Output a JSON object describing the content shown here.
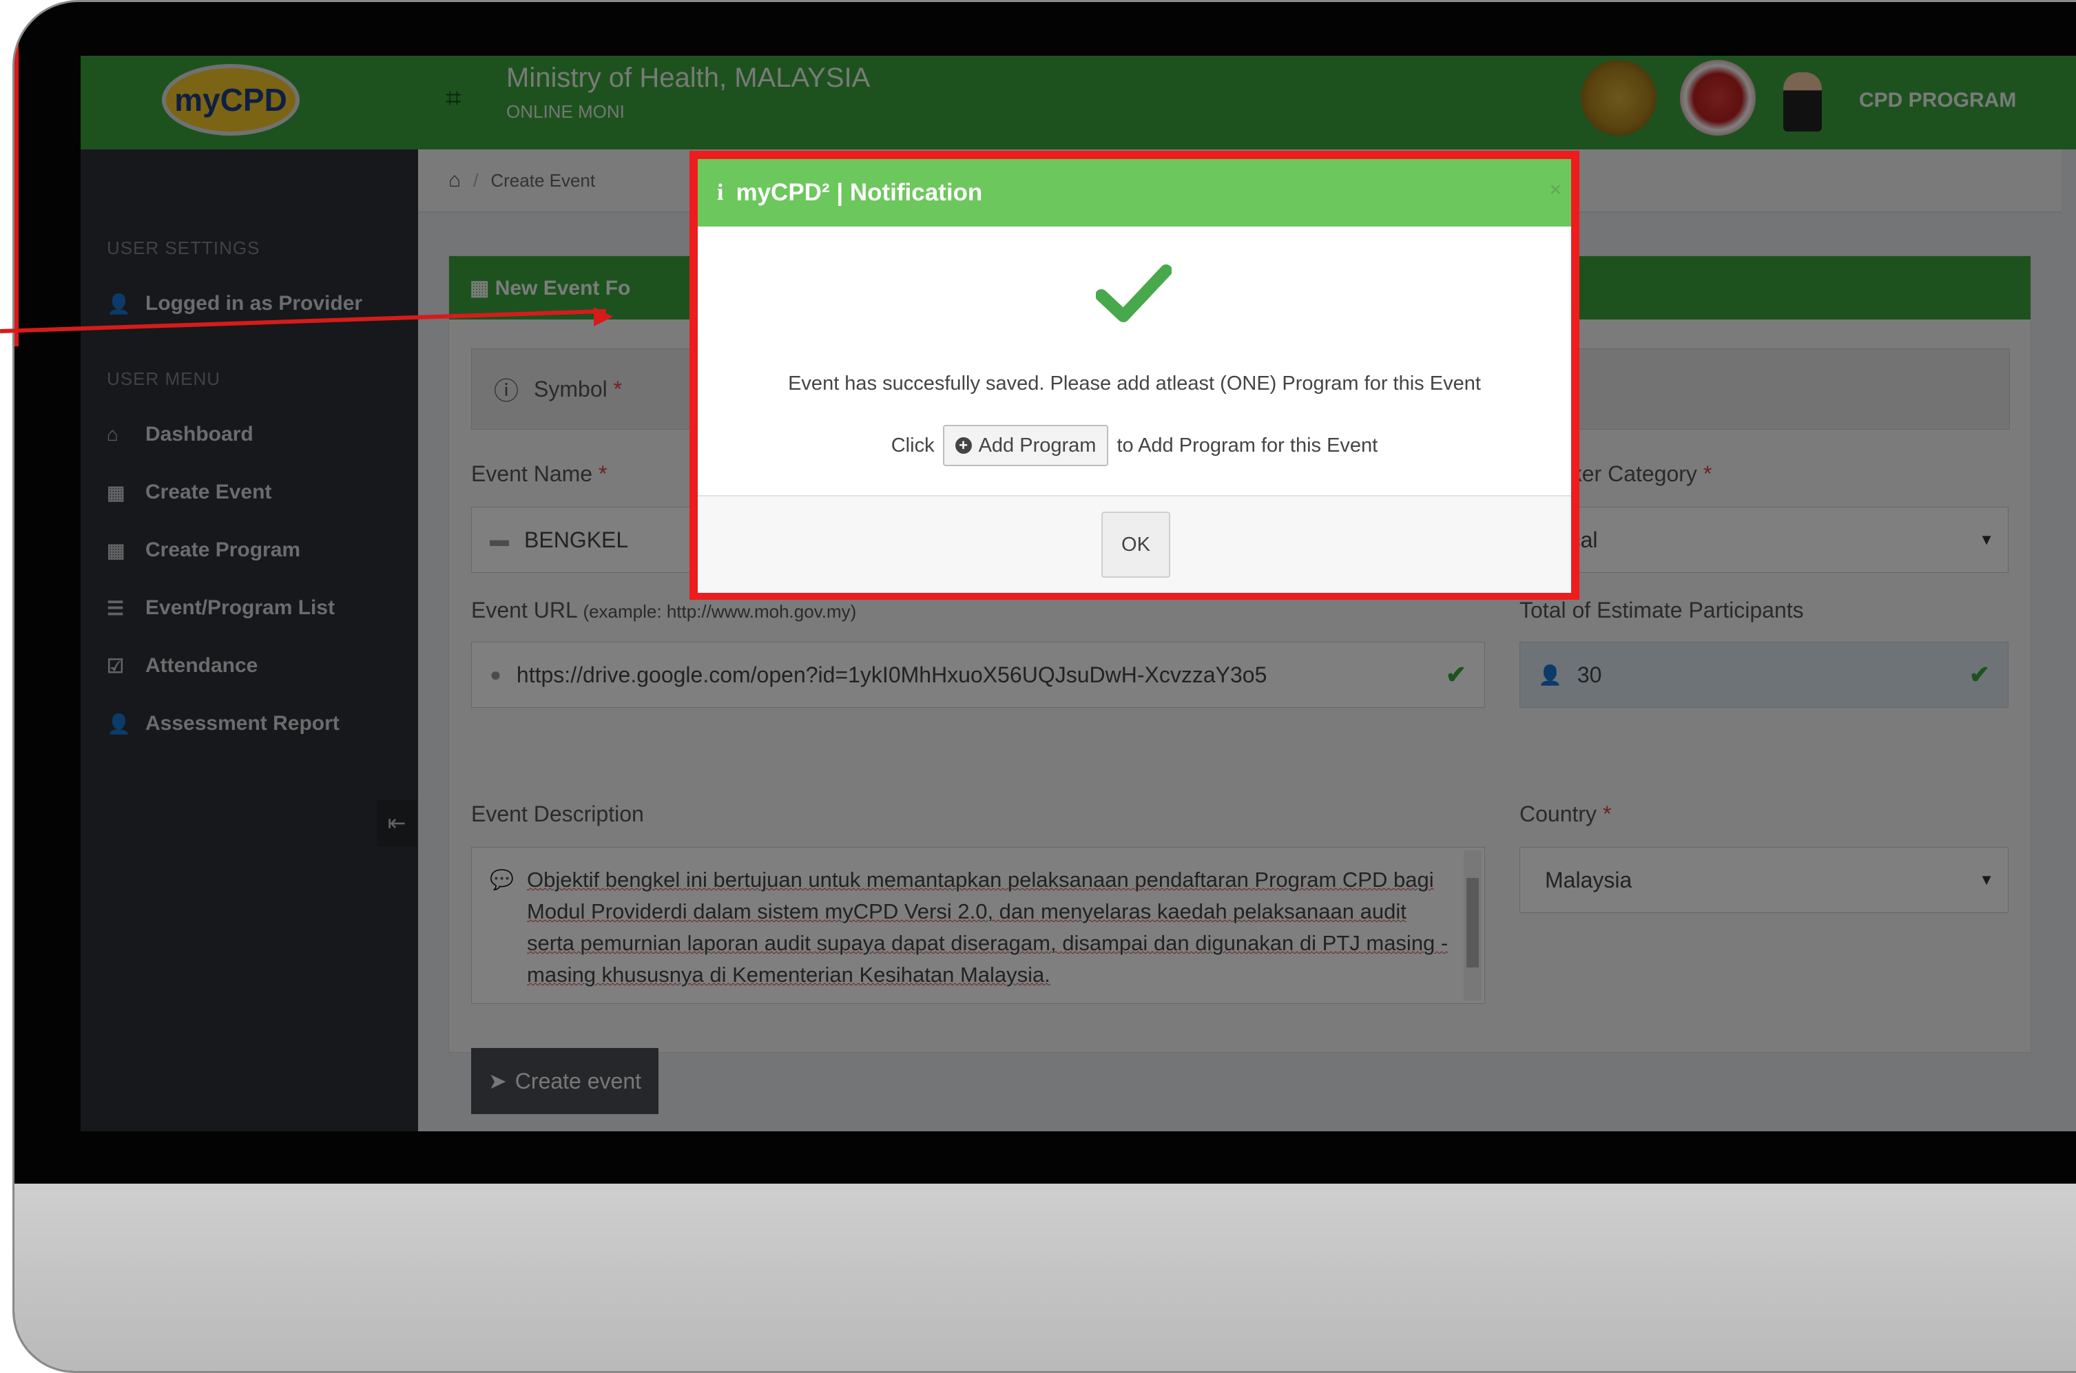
{
  "header": {
    "logo_text": "myCPD",
    "title": "Ministry of Health, MALAYSIA",
    "subtitle": "ONLINE MONI",
    "program_label": "CPD PROGRAM"
  },
  "sidebar": {
    "settings_heading": "USER SETTINGS",
    "logged_in": "Logged in as Provider",
    "menu_heading": "USER MENU",
    "items": [
      {
        "label": "Dashboard",
        "icon": "home-icon"
      },
      {
        "label": "Create Event",
        "icon": "calendar-icon"
      },
      {
        "label": "Create Program",
        "icon": "calendar-icon"
      },
      {
        "label": "Event/Program List",
        "icon": "list-icon"
      },
      {
        "label": "Attendance",
        "icon": "checkbox-icon"
      },
      {
        "label": "Assessment Report",
        "icon": "user-icon"
      }
    ]
  },
  "breadcrumb": {
    "current": "Create Event"
  },
  "form": {
    "panel_title": "New Event Fo",
    "symbol_label": "Symbol",
    "event_name_label": "Event Name",
    "event_name_value": "BENGKEL",
    "speaker_category_label": "Speaker Category",
    "speaker_category_value": "Local",
    "event_url_label": "Event URL",
    "event_url_hint": "(example: http://www.moh.gov.my)",
    "event_url_value": "https://drive.google.com/open?id=1ykI0MhHxuoX56UQJsuDwH-XcvzzaY3o5",
    "participants_label": "Total of Estimate Participants",
    "participants_value": "30",
    "description_label": "Event Description",
    "description_value": "Objektif bengkel ini bertujuan untuk memantapkan pelaksanaan pendaftaran Program CPD bagi Modul Providerdi dalam sistem myCPD Versi 2.0, dan menyelaras kaedah pelaksanaan audit serta pemurnian laporan audit supaya dapat diseragam, disampai dan digunakan di PTJ masing - masing khususnya di Kementerian Kesihatan Malaysia.",
    "country_label": "Country",
    "country_value": "Malaysia",
    "required_mark": "*",
    "submit_label": "Create event"
  },
  "modal": {
    "title": "myCPD² | Notification",
    "close": "×",
    "message": "Event has succesfully saved. Please add atleast (ONE) Program for this Event",
    "click_label": "Click",
    "add_program_label": "Add Program",
    "after_label": "to Add Program for this Event",
    "ok_label": "OK"
  },
  "colors": {
    "brand_green": "#3aa43f",
    "modal_header": "#6cc75c",
    "highlight_red": "#ee1c1c",
    "sidebar": "#2c3136"
  }
}
